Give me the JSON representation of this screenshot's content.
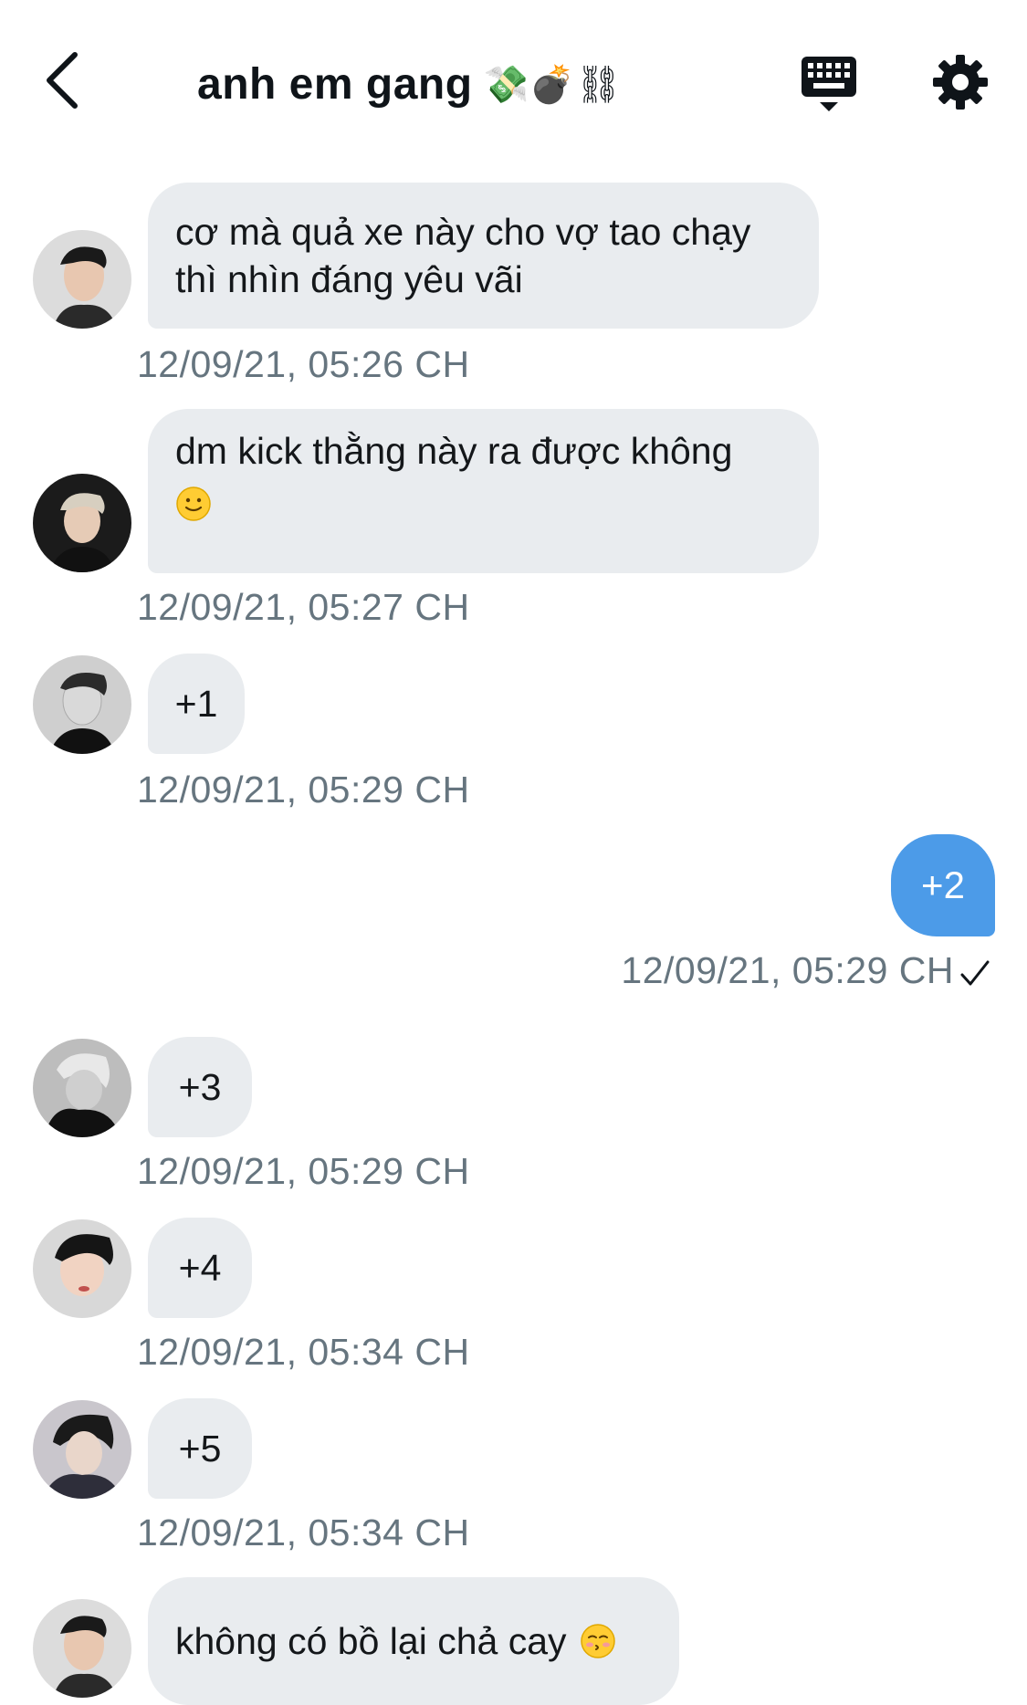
{
  "header": {
    "title": "anh em gang",
    "title_emoji": "💸💣⛓",
    "back_icon": "chevron-left-icon",
    "keyboard_icon": "keyboard-icon",
    "settings_icon": "gear-icon"
  },
  "colors": {
    "incoming_bubble": "#e9ecef",
    "outgoing_bubble": "#4c9be8",
    "timestamp": "#66757f"
  },
  "messages": [
    {
      "direction": "incoming",
      "text": "cơ mà quả xe này cho vợ tao chạy\nthì nhìn đáng yêu vãi",
      "time": "12/09/21, 05:26 CH"
    },
    {
      "direction": "incoming",
      "text": "dm kick thằng này ra được không",
      "emoji": "slightly-smiling-face",
      "time": "12/09/21, 05:27 CH"
    },
    {
      "direction": "incoming",
      "text": "+1",
      "time": "12/09/21, 05:29 CH"
    },
    {
      "direction": "outgoing",
      "text": "+2",
      "time": "12/09/21, 05:29 CH",
      "status_icon": "checkmark-icon"
    },
    {
      "direction": "incoming",
      "text": "+3",
      "time": "12/09/21, 05:29 CH"
    },
    {
      "direction": "incoming",
      "text": "+4",
      "time": "12/09/21, 05:34 CH"
    },
    {
      "direction": "incoming",
      "text": "+5",
      "time": "12/09/21, 05:34 CH"
    },
    {
      "direction": "incoming",
      "text": "không có bồ lại chả cay",
      "emoji": "kissing-face-with-closed-eyes",
      "time": ""
    }
  ]
}
